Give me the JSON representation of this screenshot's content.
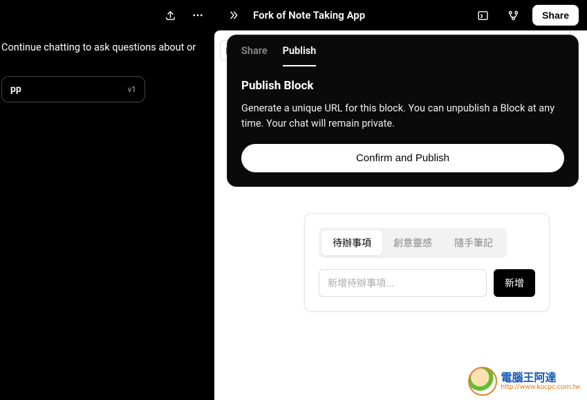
{
  "left": {
    "chat_text": "Continue chatting to ask questions about or",
    "card_label": "pp",
    "version": "v1"
  },
  "header": {
    "title": "Fork of Note Taking App",
    "share_label": "Share"
  },
  "popup": {
    "tab_share": "Share",
    "tab_publish": "Publish",
    "title": "Publish Block",
    "desc": "Generate a unique URL for this block. You can unpublish a Block at any time. Your chat will remain private.",
    "confirm_label": "Confirm and Publish"
  },
  "app": {
    "tabs": [
      "待辦事項",
      "創意靈感",
      "隨手筆記"
    ],
    "input_placeholder": "新增待辦事項...",
    "add_label": "新增"
  },
  "watermark": {
    "main": "電腦王阿達",
    "sub": "http://www.kocpc.com.tw"
  }
}
